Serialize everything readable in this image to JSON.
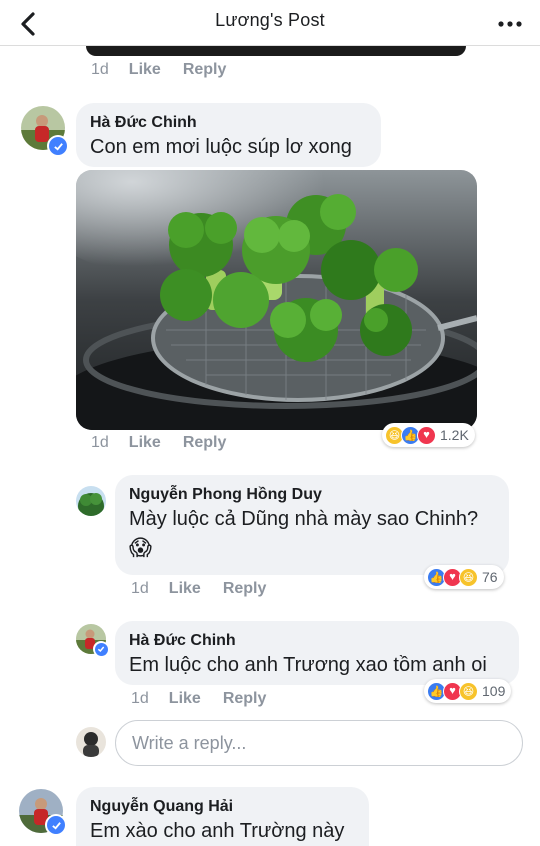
{
  "header": {
    "title": "Lương's Post"
  },
  "comments": [
    {
      "actions": {
        "time": "1d",
        "like": "Like",
        "reply": "Reply"
      }
    },
    {
      "author": "Hà Đức Chinh",
      "text": "Con em mơi luộc súp lơ xong",
      "actions": {
        "time": "1d",
        "like": "Like",
        "reply": "Reply"
      },
      "reactions": {
        "types": [
          "haha",
          "like",
          "love"
        ],
        "count": "1.2K"
      }
    }
  ],
  "replies": [
    {
      "author": "Nguyễn Phong Hồng Duy",
      "text": "Mày luộc cả Dũng nhà mày sao Chinh?",
      "emoji": "😱",
      "actions": {
        "time": "1d",
        "like": "Like",
        "reply": "Reply"
      },
      "reactions": {
        "types": [
          "like",
          "love",
          "haha"
        ],
        "count": "76"
      }
    },
    {
      "author": "Hà Đức Chinh",
      "text": "Em luộc cho anh Trương xao tồm anh oi",
      "actions": {
        "time": "1d",
        "like": "Like",
        "reply": "Reply"
      },
      "reactions": {
        "types": [
          "like",
          "love",
          "haha"
        ],
        "count": "109"
      }
    }
  ],
  "reply_box": {
    "placeholder": "Write a reply..."
  },
  "next_comment": {
    "author": "Nguyễn Quang Hải",
    "text": "Em xào cho anh Trường này"
  },
  "colors": {
    "accent": "#4080ff",
    "meta": "#8d949e",
    "bubble": "#f0f2f5"
  }
}
